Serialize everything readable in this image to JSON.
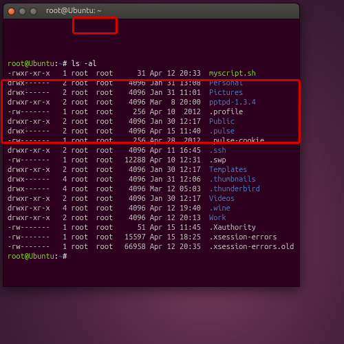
{
  "window": {
    "title": "root@Ubuntu: ~"
  },
  "prompt": {
    "userhost": "root@Ubuntu",
    "path": "~",
    "symbol": "#"
  },
  "command": "ls -al",
  "rows": [
    {
      "perms": "-rwxr-xr-x",
      "links": "1",
      "owner": "root",
      "group": "root",
      "size": "31",
      "date": "Apr 12 20:33",
      "name": "myscript.sh",
      "cls": "exec"
    },
    {
      "perms": "drwx------",
      "links": "2",
      "owner": "root",
      "group": "root",
      "size": "4096",
      "date": "Jan 31 13:08",
      "name": "Personal",
      "cls": "dir"
    },
    {
      "perms": "drwx------",
      "links": "2",
      "owner": "root",
      "group": "root",
      "size": "4096",
      "date": "Jan 31 11:01",
      "name": "Pictures",
      "cls": "dir"
    },
    {
      "perms": "drwxr-xr-x",
      "links": "2",
      "owner": "root",
      "group": "root",
      "size": "4096",
      "date": "Mar  8 20:00",
      "name": "pptpd-1.3.4",
      "cls": "dir"
    },
    {
      "perms": "-rw-------",
      "links": "1",
      "owner": "root",
      "group": "root",
      "size": "256",
      "date": "Apr 10  2012",
      "name": ".profile",
      "cls": "file"
    },
    {
      "perms": "drwxr-xr-x",
      "links": "2",
      "owner": "root",
      "group": "root",
      "size": "4096",
      "date": "Jan 30 12:17",
      "name": "Public",
      "cls": "dir"
    },
    {
      "perms": "drwx------",
      "links": "2",
      "owner": "root",
      "group": "root",
      "size": "4096",
      "date": "Apr 15 11:40",
      "name": ".pulse",
      "cls": "dir"
    },
    {
      "perms": "-rw-------",
      "links": "1",
      "owner": "root",
      "group": "root",
      "size": "256",
      "date": "Apr 28  2012",
      "name": ".pulse-cookie",
      "cls": "file"
    },
    {
      "perms": "drwxr-xr-x",
      "links": "2",
      "owner": "root",
      "group": "root",
      "size": "4096",
      "date": "Apr 11 16:45",
      "name": ".ssh",
      "cls": "dir"
    },
    {
      "perms": "-rw-------",
      "links": "1",
      "owner": "root",
      "group": "root",
      "size": "12288",
      "date": "Apr 10 12:31",
      "name": ".swp",
      "cls": "file"
    },
    {
      "perms": "drwxr-xr-x",
      "links": "2",
      "owner": "root",
      "group": "root",
      "size": "4096",
      "date": "Jan 30 12:17",
      "name": "Templates",
      "cls": "dir"
    },
    {
      "perms": "drwx------",
      "links": "4",
      "owner": "root",
      "group": "root",
      "size": "4096",
      "date": "Jan 31 12:06",
      "name": ".thumbnails",
      "cls": "dir"
    },
    {
      "perms": "drwx------",
      "links": "4",
      "owner": "root",
      "group": "root",
      "size": "4096",
      "date": "Mar 12 05:03",
      "name": ".thunderbird",
      "cls": "dir"
    },
    {
      "perms": "drwxr-xr-x",
      "links": "2",
      "owner": "root",
      "group": "root",
      "size": "4096",
      "date": "Jan 30 12:17",
      "name": "Videos",
      "cls": "dir"
    },
    {
      "perms": "drwxr-xr-x",
      "links": "4",
      "owner": "root",
      "group": "root",
      "size": "4096",
      "date": "Apr 12 19:40",
      "name": ".wine",
      "cls": "dir"
    },
    {
      "perms": "drwxr-xr-x",
      "links": "2",
      "owner": "root",
      "group": "root",
      "size": "4096",
      "date": "Apr 12 20:13",
      "name": "Work",
      "cls": "dir"
    },
    {
      "perms": "-rw-------",
      "links": "1",
      "owner": "root",
      "group": "root",
      "size": "51",
      "date": "Apr 15 11:45",
      "name": ".Xauthority",
      "cls": "file"
    },
    {
      "perms": "-rw-------",
      "links": "1",
      "owner": "root",
      "group": "root",
      "size": "15597",
      "date": "Apr 15 18:25",
      "name": ".xsession-errors",
      "cls": "file"
    },
    {
      "perms": "-rw-------",
      "links": "1",
      "owner": "root",
      "group": "root",
      "size": "66958",
      "date": "Apr 12 20:35",
      "name": ".xsession-errors.old",
      "cls": "file"
    }
  ],
  "highlights": {
    "cmd": true,
    "block_start": 5,
    "block_end": 10
  }
}
